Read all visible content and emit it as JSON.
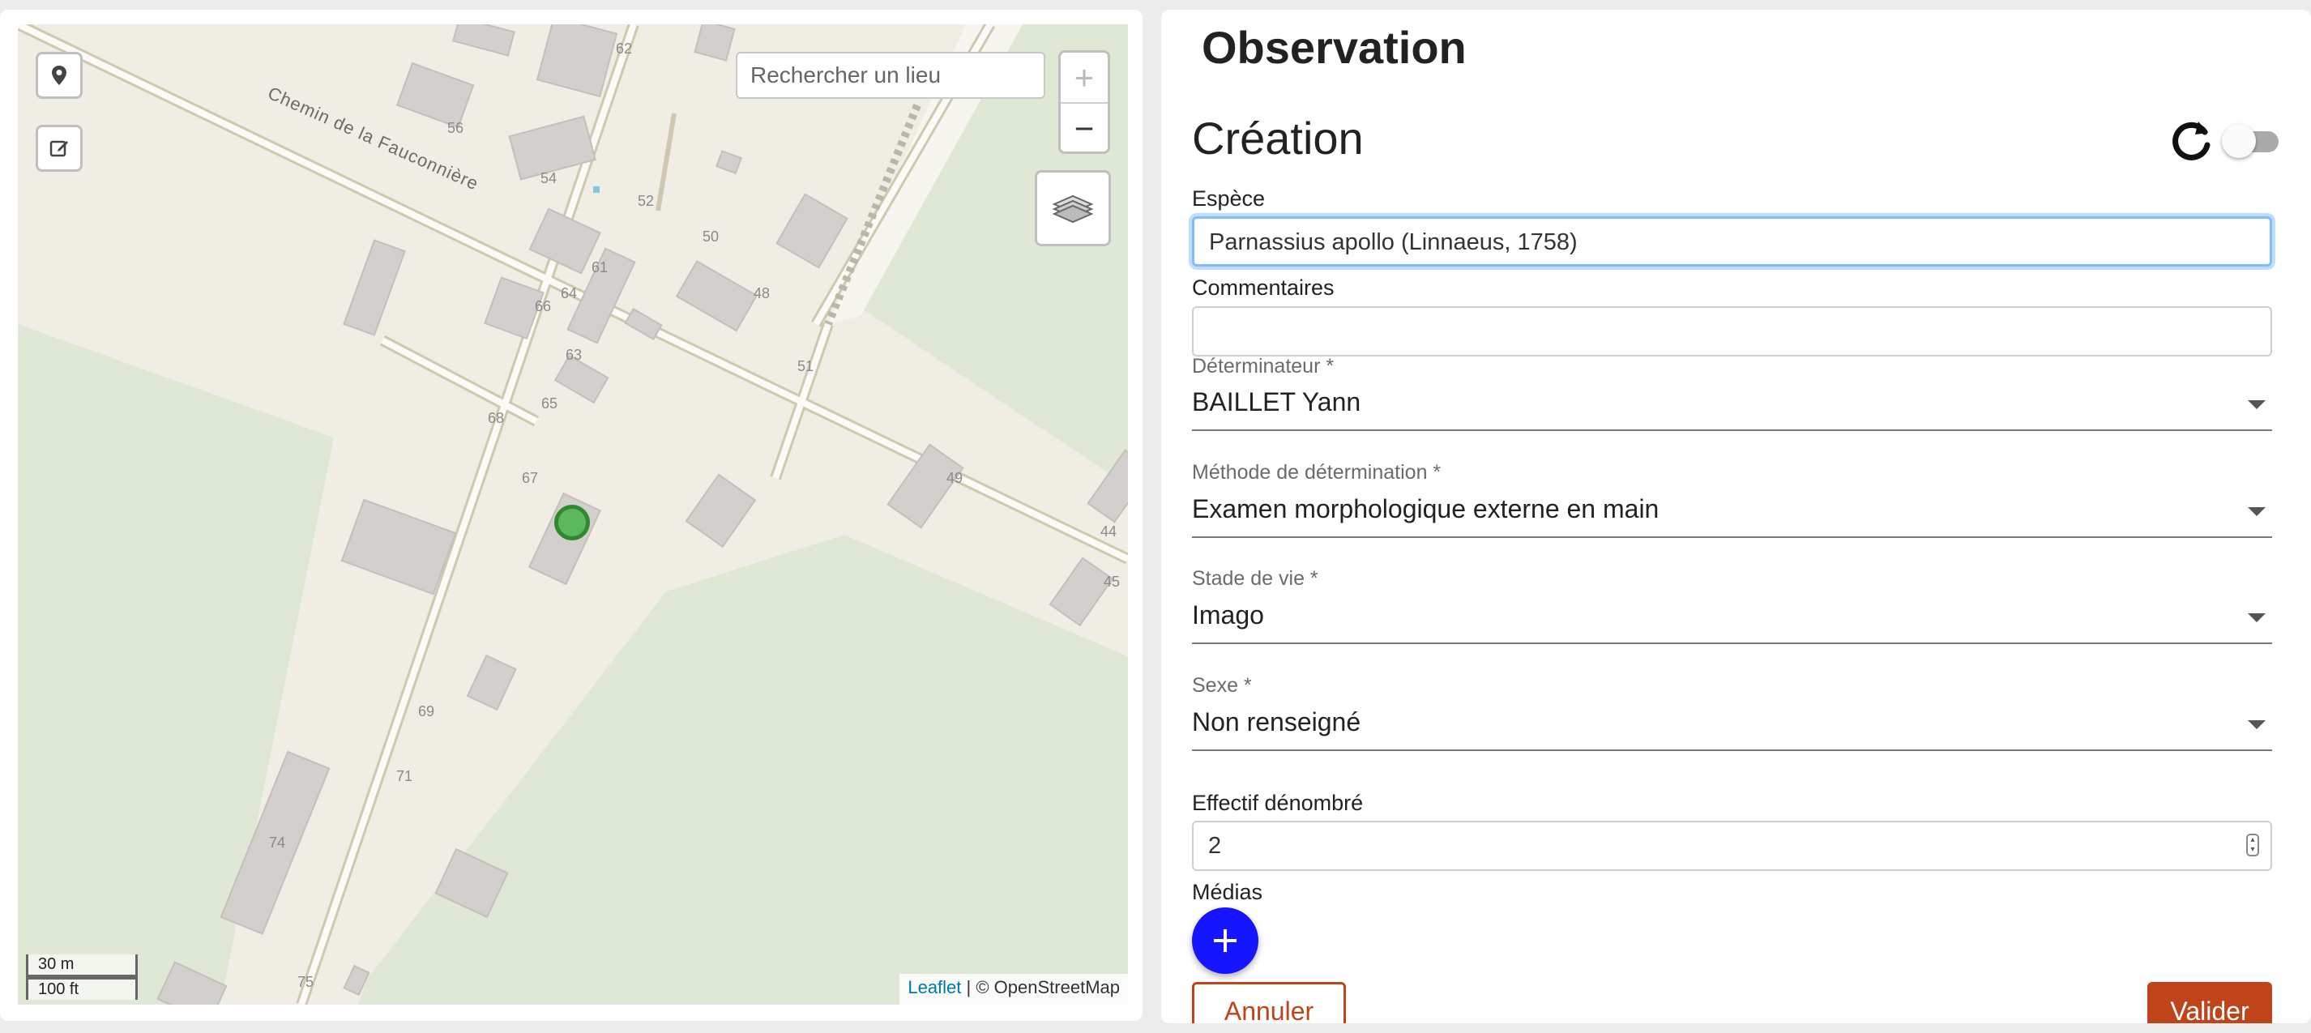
{
  "map": {
    "search_placeholder": "Rechercher un lieu",
    "zoom_in_label": "+",
    "zoom_out_label": "−",
    "road_name": "Chemin de la Fauconnière",
    "house_numbers": [
      "62",
      "56",
      "54",
      "52",
      "50",
      "61",
      "64",
      "66",
      "48",
      "63",
      "51",
      "65",
      "68",
      "67",
      "49",
      "44",
      "45",
      "69",
      "71",
      "74",
      "75"
    ],
    "scale_metric": "30 m",
    "scale_imperial": "100 ft",
    "attribution_link": "Leaflet",
    "attribution_text": "| © OpenStreetMap",
    "marker_color": "#5cb85c",
    "icons": {
      "locate": "location-pin-icon",
      "edit": "edit-icon",
      "layers": "layers-icon"
    }
  },
  "form": {
    "page_title": "Observation",
    "section_title": "Création",
    "fields": {
      "espece": {
        "label": "Espèce",
        "value": "Parnassius apollo (Linnaeus, 1758)"
      },
      "commentaires": {
        "label": "Commentaires",
        "value": ""
      },
      "determinateur": {
        "label": "Déterminateur *",
        "value": "BAILLET Yann"
      },
      "methode": {
        "label": "Méthode de détermination *",
        "value": "Examen morphologique externe en main"
      },
      "stade": {
        "label": "Stade de vie *",
        "value": "Imago"
      },
      "sexe": {
        "label": "Sexe *",
        "value": "Non renseigné"
      },
      "effectif": {
        "label": "Effectif dénombré",
        "value": "2"
      },
      "medias": {
        "label": "Médias"
      }
    },
    "add_media_label": "+",
    "cancel_label": "Annuler",
    "submit_label": "Valider",
    "colors": {
      "primary_blue": "#1515ff",
      "action_orange": "#c0441a",
      "focus_border": "#80bdff"
    }
  }
}
